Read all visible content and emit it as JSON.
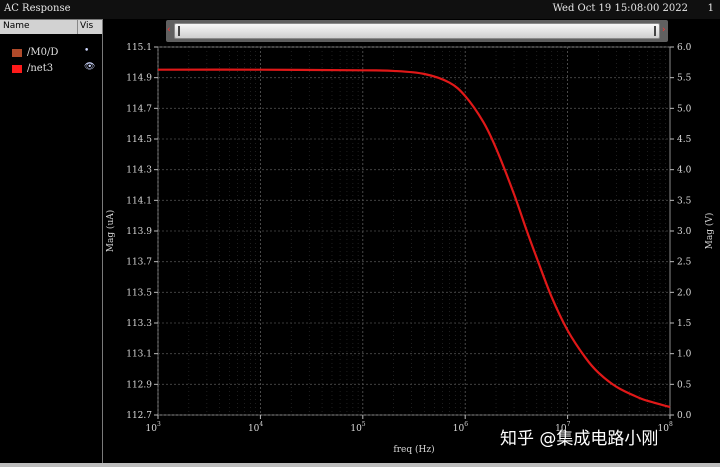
{
  "window": {
    "title": "AC Response",
    "timestamp": "Wed Oct 19 15:08:00 2022",
    "page_number": "1"
  },
  "legend": {
    "col_name": "Name",
    "col_vis": "Vis",
    "items": [
      {
        "label": "/M0/D",
        "color": "#b04a2a",
        "vis": "•"
      },
      {
        "label": "/net3",
        "color": "#ff1a1a",
        "vis": "👁"
      }
    ]
  },
  "watermark": "知乎 @集成电路小刚",
  "chart_data": {
    "type": "line",
    "xlabel": "freq (Hz)",
    "ylabel_left": "Mag (uA)",
    "ylabel_right": "Mag (V)",
    "x_scale": "log",
    "xlim": [
      1000,
      100000000
    ],
    "x_ticks": [
      {
        "value": 1000,
        "base": "10",
        "exp": "3"
      },
      {
        "value": 10000,
        "base": "10",
        "exp": "4"
      },
      {
        "value": 100000,
        "base": "10",
        "exp": "5"
      },
      {
        "value": 1000000,
        "base": "10",
        "exp": "6"
      },
      {
        "value": 10000000,
        "base": "10",
        "exp": "7"
      },
      {
        "value": 100000000,
        "base": "10",
        "exp": "8"
      }
    ],
    "ylim_left": [
      112.7,
      115.1
    ],
    "y_ticks_left": [
      "112.7",
      "112.9",
      "113.1",
      "113.3",
      "113.5",
      "113.7",
      "113.9",
      "114.1",
      "114.3",
      "114.5",
      "114.7",
      "114.9",
      "115.1"
    ],
    "ylim_right": [
      0.0,
      6.0
    ],
    "y_ticks_right": [
      "0.0",
      "0.5",
      "1.0",
      "1.5",
      "2.0",
      "2.5",
      "3.0",
      "3.5",
      "4.0",
      "4.5",
      "5.0",
      "5.5",
      "6.0"
    ],
    "grid": true,
    "series": [
      {
        "name": "/net3",
        "axis": "right",
        "color": "#e01818",
        "x": [
          1000,
          10000,
          100000,
          200000,
          400000,
          700000,
          1000000,
          1500000,
          2000000,
          3000000,
          4000000,
          5000000,
          7000000,
          10000000,
          15000000,
          20000000,
          30000000,
          50000000,
          70000000,
          100000000
        ],
        "y": [
          5.63,
          5.63,
          5.62,
          5.61,
          5.56,
          5.42,
          5.2,
          4.78,
          4.35,
          3.6,
          3.0,
          2.56,
          1.92,
          1.38,
          0.93,
          0.69,
          0.46,
          0.28,
          0.2,
          0.13
        ]
      }
    ]
  }
}
